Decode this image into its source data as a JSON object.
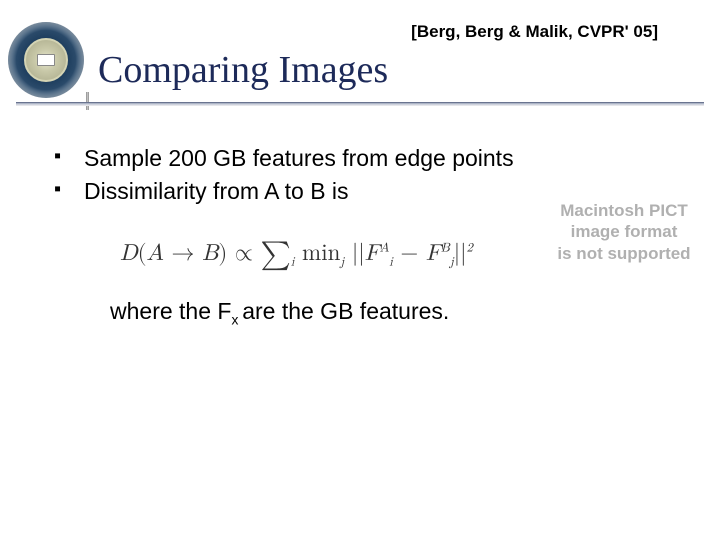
{
  "header": {
    "citation": "[Berg, Berg & Malik, CVPR' 05]",
    "title": "Comparing Images"
  },
  "bullets": [
    "Sample 200 GB features from edge points",
    "Dissimilarity from A to B is"
  ],
  "pict_placeholder": {
    "line1": "Macintosh PICT",
    "line2": "image format",
    "line3": "is not supported"
  },
  "formula": {
    "lhs_D": "D",
    "arrow": "→",
    "A": "A",
    "B": "B",
    "propto": "∝",
    "sigma": "∑",
    "idx_i": "i",
    "min": "min",
    "idx_j": "j",
    "F": "F",
    "supA": "A",
    "subI": "i",
    "supB": "B",
    "subJ": "j",
    "sq": "2"
  },
  "closing": {
    "pre": "where the F",
    "sub": "x ",
    "post": "are the GB features."
  }
}
